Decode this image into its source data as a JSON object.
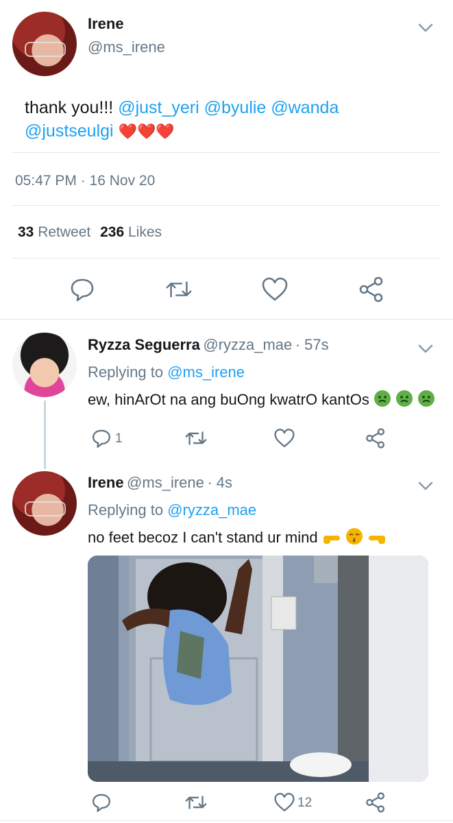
{
  "main_tweet": {
    "author_name": "Irene",
    "author_handle": "@ms_irene",
    "text_prefix": "thank you!!!",
    "mentions": [
      "@just_yeri",
      "@byulie",
      "@wanda",
      "@justseulgi"
    ],
    "hearts": "❤️❤️❤️",
    "timestamp": "05:47 PM · 16 Nov 20",
    "retweet_count": "33",
    "retweet_label": "Retweet",
    "like_count": "236",
    "like_label": "Likes"
  },
  "reply_1": {
    "author_name": "Ryzza Seguerra",
    "author_handle": "@ryzza_mae",
    "time": "· 57s",
    "replying_label": "Replying to",
    "replying_to": "@ms_irene",
    "text": "ew, hinArOt na ang buOng kwatrO kantOs",
    "reply_count": "1"
  },
  "reply_2": {
    "author_name": "Irene",
    "author_handle": "@ms_irene",
    "time": "· 4s",
    "replying_label": "Replying to",
    "replying_to": "@ryzza_mae",
    "text": "no feet becoz I can't stand ur mind",
    "like_count": "12"
  },
  "colors": {
    "link": "#1da1f2",
    "secondary_text": "#657786",
    "icon": "#657786",
    "divider": "#e1e8ed"
  },
  "icons": [
    "chevron-down-icon",
    "reply-icon",
    "retweet-icon",
    "like-icon",
    "share-icon"
  ]
}
